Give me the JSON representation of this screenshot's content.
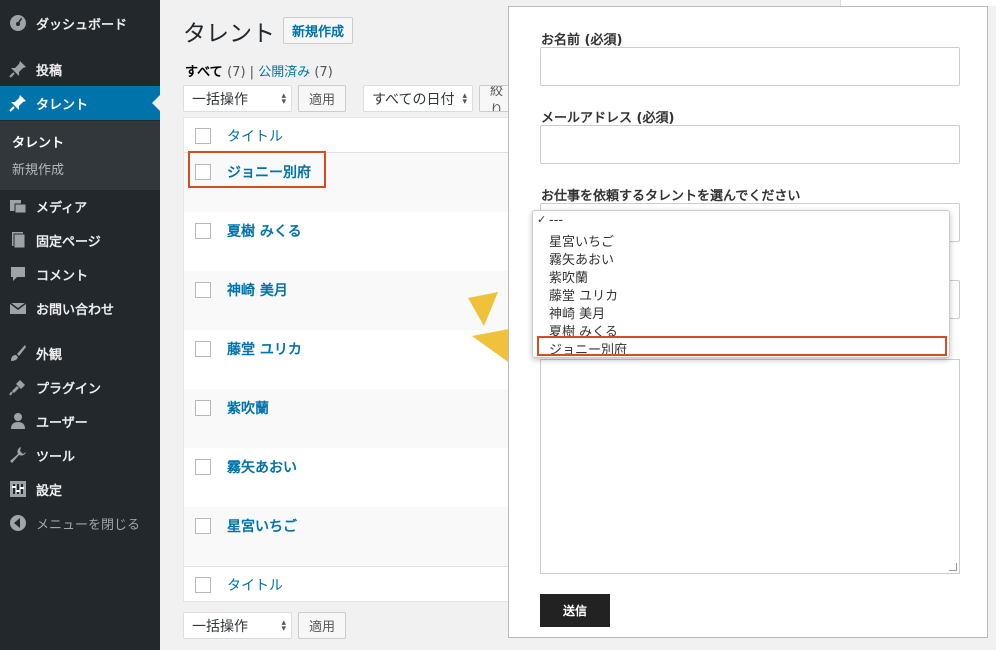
{
  "sidebar": {
    "items": [
      {
        "label": "ダッシュボード",
        "icon": "dashboard-icon"
      },
      {
        "label": "投稿",
        "icon": "pin-icon"
      },
      {
        "label": "タレント",
        "icon": "pin-icon"
      },
      {
        "label": "メディア",
        "icon": "media-icon"
      },
      {
        "label": "固定ページ",
        "icon": "page-icon"
      },
      {
        "label": "コメント",
        "icon": "comment-icon"
      },
      {
        "label": "お問い合わせ",
        "icon": "mail-icon"
      },
      {
        "label": "外観",
        "icon": "brush-icon"
      },
      {
        "label": "プラグイン",
        "icon": "plugin-icon"
      },
      {
        "label": "ユーザー",
        "icon": "user-icon"
      },
      {
        "label": "ツール",
        "icon": "wrench-icon"
      },
      {
        "label": "設定",
        "icon": "settings-icon"
      },
      {
        "label": "メニューを閉じる",
        "icon": "collapse-icon"
      }
    ],
    "submenu": [
      {
        "label": "タレント"
      },
      {
        "label": "新規作成"
      }
    ]
  },
  "header": {
    "title": "タレント",
    "add_new": "新規作成"
  },
  "filters": {
    "all_label": "すべて",
    "all_count": "(7)",
    "separator": "|",
    "published_label": "公開済み",
    "published_count": "(7)",
    "bulk_action": "一括操作",
    "apply": "適用",
    "all_dates": "すべての日付",
    "filter_partial": "絞り"
  },
  "table": {
    "column_title": "タイトル",
    "rows": [
      "ジョニー別府",
      "夏樹 みくる",
      "神崎 美月",
      "藤堂 ユリカ",
      "紫吹蘭",
      "霧矢あおい",
      "星宮いちご"
    ]
  },
  "form": {
    "name_label": "お名前 (必須)",
    "email_label": "メールアドレス (必須)",
    "talent_label": "お仕事を依頼するタレントを選んでください",
    "submit": "送信",
    "options": [
      "---",
      "星宮いちご",
      "霧矢あおい",
      "紫吹蘭",
      "藤堂 ユリカ",
      "神崎 美月",
      "夏樹 みくる",
      "ジョニー別府"
    ],
    "checkmark": "✓"
  },
  "colors": {
    "sidebar_bg": "#23282d",
    "accent": "#0073aa",
    "highlight": "#d54e21",
    "arrow": "#f0c23b"
  }
}
